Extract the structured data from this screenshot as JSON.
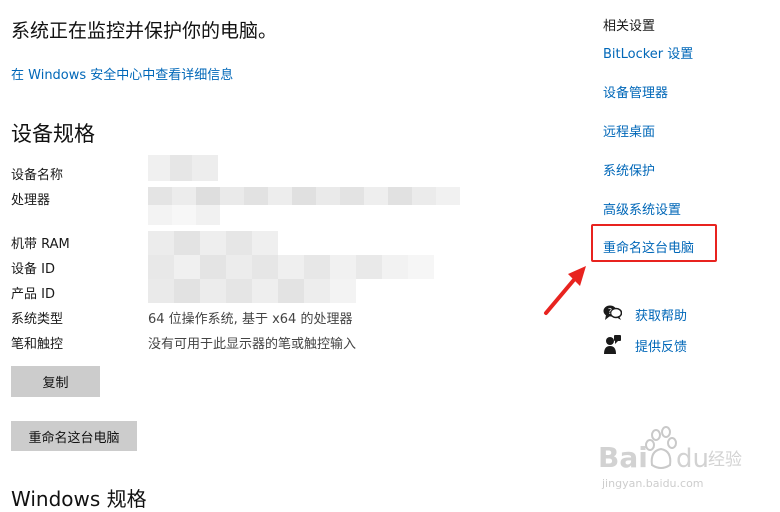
{
  "main": {
    "status_text": "系统正在监控并保护你的电脑。",
    "security_link": "在 Windows 安全中心中查看详细信息",
    "specs_title": "设备规格",
    "specs": [
      {
        "label": "设备名称",
        "value": ""
      },
      {
        "label": "处理器",
        "value": ""
      },
      {
        "label": "机带 RAM",
        "value": ""
      },
      {
        "label": "设备 ID",
        "value": ""
      },
      {
        "label": "产品 ID",
        "value": ""
      },
      {
        "label": "系统类型",
        "value": "64 位操作系统, 基于 x64 的处理器"
      },
      {
        "label": "笔和触控",
        "value": "没有可用于此显示器的笔或触控输入"
      }
    ],
    "copy_button": "复制",
    "rename_button": "重命名这台电脑",
    "windows_specs_title": "Windows 规格"
  },
  "related": {
    "title": "相关设置",
    "links": [
      "BitLocker 设置",
      "设备管理器",
      "远程桌面",
      "系统保护",
      "高级系统设置",
      "重命名这台电脑"
    ],
    "help_link": "获取帮助",
    "feedback_link": "提供反馈"
  },
  "colors": {
    "link": "#0067b8",
    "highlight": "#e8231f",
    "button_bg": "#cccccc"
  },
  "watermark": {
    "brand": "Baidu",
    "brand_cn": "经验",
    "url": "jingyan.baidu.com"
  }
}
